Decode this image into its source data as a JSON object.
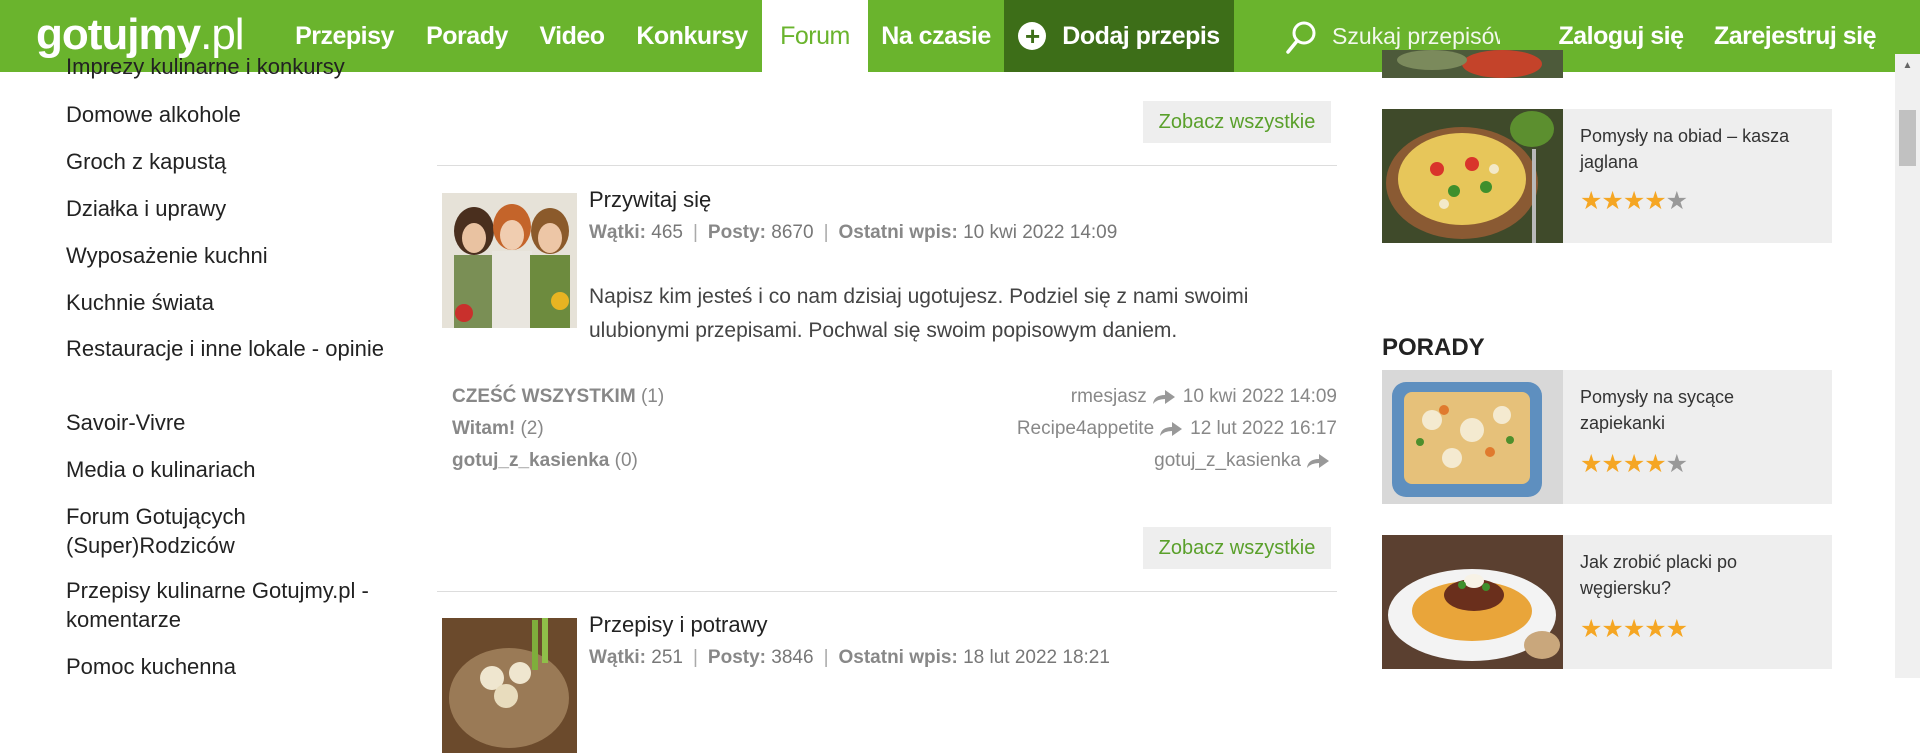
{
  "header": {
    "logo_main": "gotujmy",
    "logo_suffix": ".pl",
    "nav": [
      "Przepisy",
      "Porady",
      "Video",
      "Konkursy",
      "Forum",
      "Na czasie"
    ],
    "add_recipe": "Dodaj przepis",
    "search_placeholder": "Szukaj przepisów",
    "login": "Zaloguj się",
    "register": "Zarejestruj się",
    "colors": {
      "brand": "#6ab42d",
      "dark": "#3d6e18"
    }
  },
  "sidebar": {
    "items": [
      "Imprezy kulinarne i konkursy",
      "Domowe alkohole",
      "Groch z kapustą",
      "Działka i uprawy",
      "Wyposażenie kuchni",
      "Kuchnie świata",
      "Restauracje i inne lokale - opinie",
      "Savoir-Vivre",
      "Media o kulinariach",
      "Forum Gotujących (Super)Rodziców",
      "Przepisy kulinarne Gotujmy.pl - komentarze",
      "Pomoc kuchenna"
    ]
  },
  "forum": {
    "see_all": "Zobacz wszystkie",
    "labels": {
      "threads": "Wątki:",
      "posts": "Posty:",
      "last": "Ostatni wpis:"
    },
    "sections": [
      {
        "title": "Przywitaj się",
        "threads": "465",
        "posts": "8670",
        "last_post": "10 kwi 2022 14:09",
        "description": "Napisz kim jesteś i co nam dzisiaj ugotujesz. Podziel się z nami swoimi ulubionymi przepisami. Pochwal się swoim popisowym daniem.",
        "topics": [
          {
            "title": "CZEŚĆ WSZYSTKIM",
            "count": "(1)",
            "author": "rmesjasz",
            "date": "10 kwi 2022 14:09"
          },
          {
            "title": "Witam!",
            "count": "(2)",
            "author": "Recipe4appetite",
            "date": "12 lut 2022 16:17"
          },
          {
            "title": "gotuj_z_kasienka",
            "count": "(0)",
            "author": "gotuj_z_kasienka",
            "date": ""
          }
        ]
      },
      {
        "title": "Przepisy i potrawy",
        "threads": "251",
        "posts": "3846",
        "last_post": "18 lut 2022 18:21"
      }
    ]
  },
  "right": {
    "cards_top": [
      {
        "title": "Pomysły na obiad – kasza jaglana",
        "rating": 4
      }
    ],
    "porady_heading": "PORADY",
    "porady": [
      {
        "title": "Pomysły na sycące zapiekanki",
        "rating": 4
      },
      {
        "title": "Jak zrobić placki po węgiersku?",
        "rating": 5
      }
    ]
  }
}
